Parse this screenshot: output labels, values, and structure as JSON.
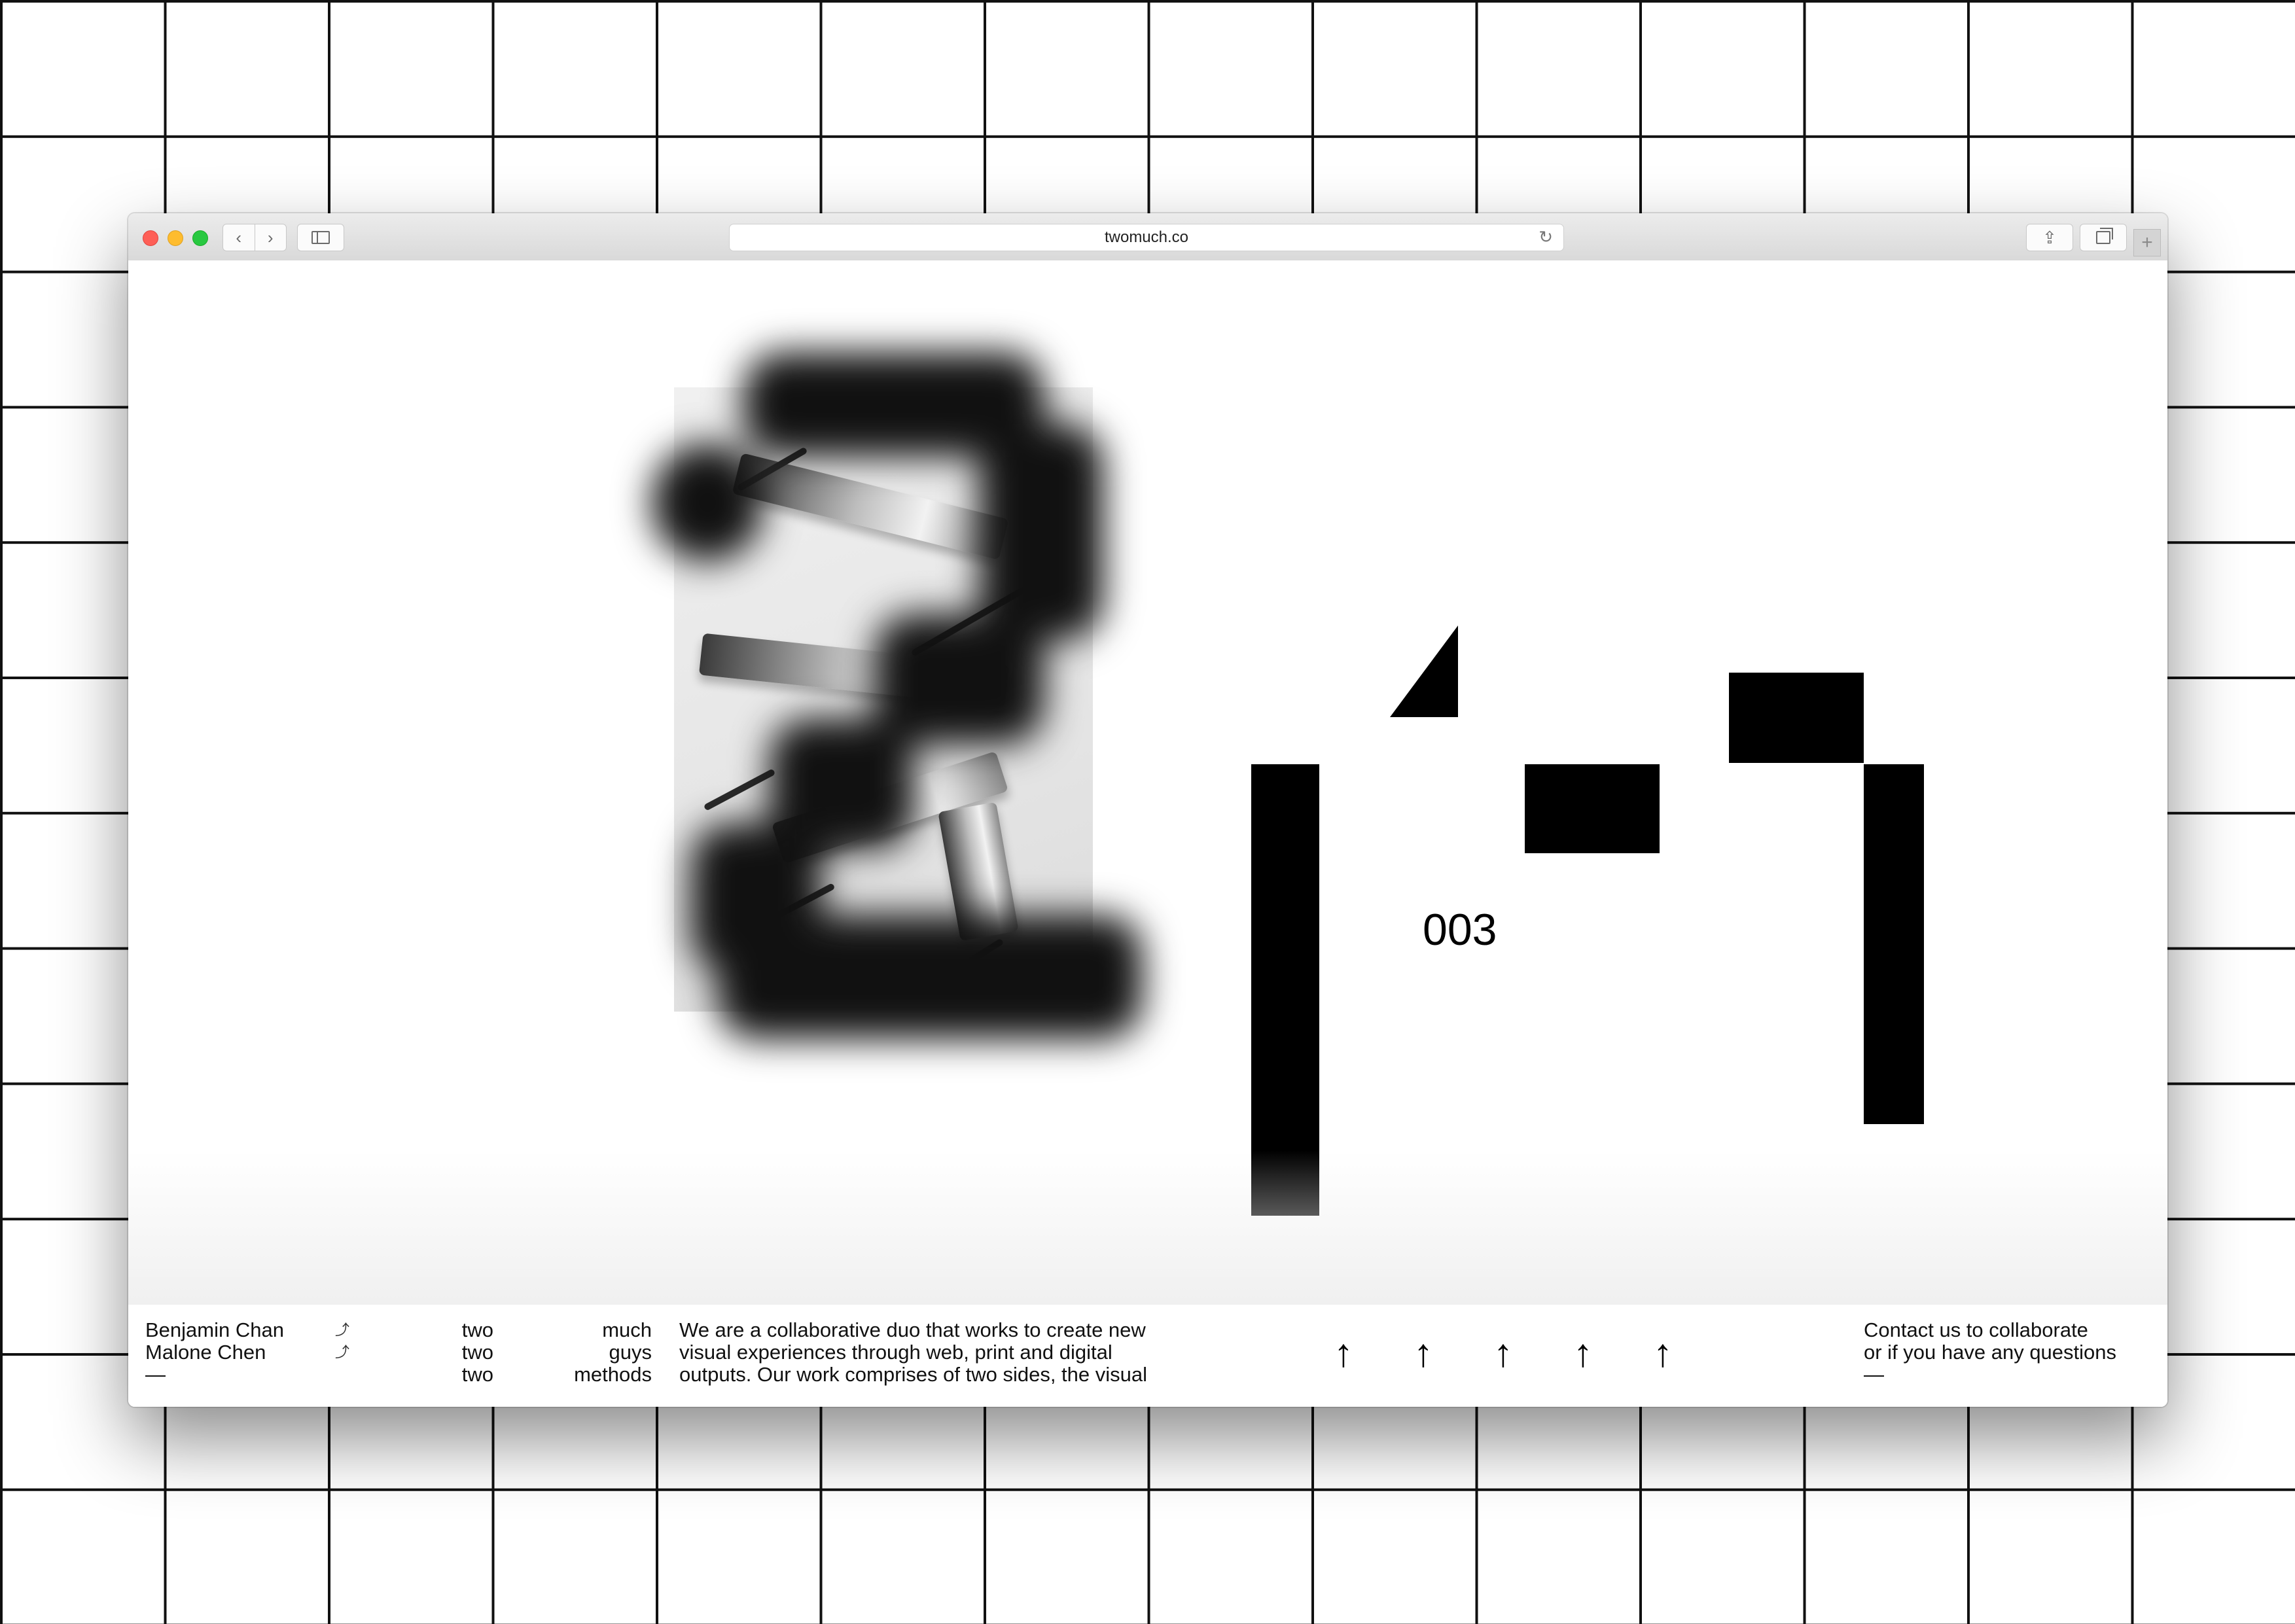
{
  "browser": {
    "url": "twomuch.co",
    "back_glyph": "‹",
    "forward_glyph": "›",
    "reload_glyph": "↻",
    "share_glyph": "⇪",
    "newtab_glyph": "+"
  },
  "hero": {
    "project_number": "003"
  },
  "footer": {
    "names": [
      "Benjamin Chan",
      "Malone Chen",
      "—"
    ],
    "turn_icons": [
      "⤴",
      "⤴"
    ],
    "twos": [
      "two",
      "two",
      "two"
    ],
    "words": [
      "much",
      "guys",
      "methods"
    ],
    "about": [
      "We are a collaborative duo that works to create new",
      "visual experiences through web, print and digital",
      "outputs. Our work comprises of two sides, the visual"
    ],
    "arrow_glyph": "↑",
    "contact": [
      "Contact us to collaborate",
      "or if you have any questions",
      "—"
    ]
  },
  "colors": {
    "accent": "#000000",
    "traffic_red": "#fe5f57",
    "traffic_yellow": "#febc2e",
    "traffic_green": "#28c840"
  }
}
